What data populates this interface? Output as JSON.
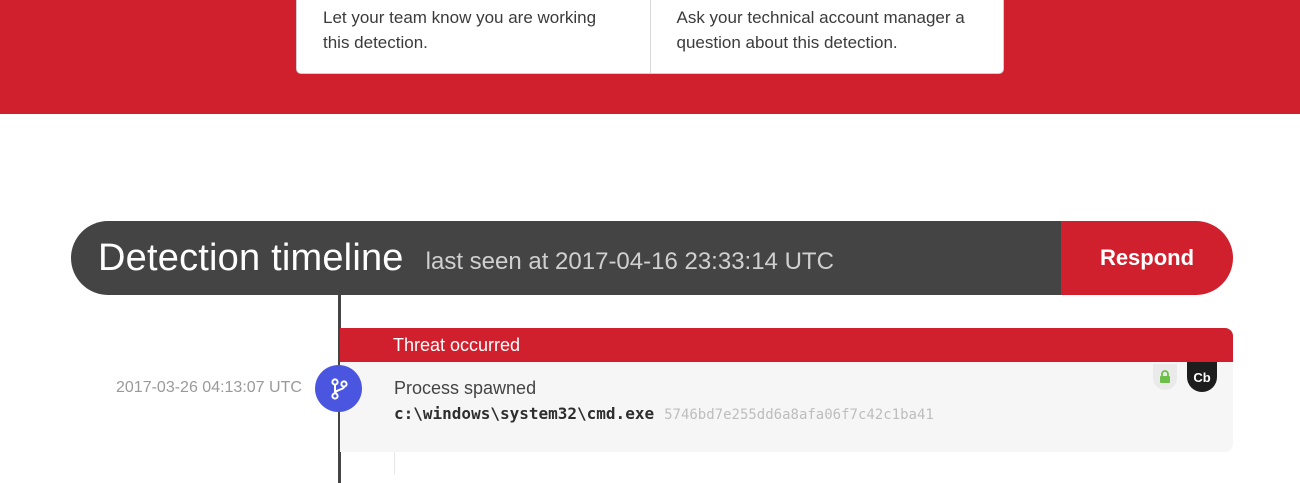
{
  "cards": [
    {
      "text": "Let your team know you are working this detection."
    },
    {
      "text": "Ask your technical account manager a question about this detection."
    }
  ],
  "timeline": {
    "title": "Detection timeline",
    "last_seen": "last seen at 2017-04-16 23:33:14 UTC",
    "respond_label": "Respond"
  },
  "event": {
    "header": "Threat occurred",
    "timestamp": "2017-03-26 04:13:07 UTC",
    "type": "Process spawned",
    "path": "c:\\windows\\system32\\cmd.exe",
    "hash": "5746bd7e255dd6a8afa06f7c42c1ba41",
    "badges": {
      "lock_icon": "lock-icon",
      "cb_label": "Cb"
    },
    "node_icon": "branch-icon"
  },
  "colors": {
    "brand_red": "#d0202e",
    "header_dark": "#444444",
    "node_blue": "#4a55e0",
    "lock_green": "#6cc04a"
  }
}
